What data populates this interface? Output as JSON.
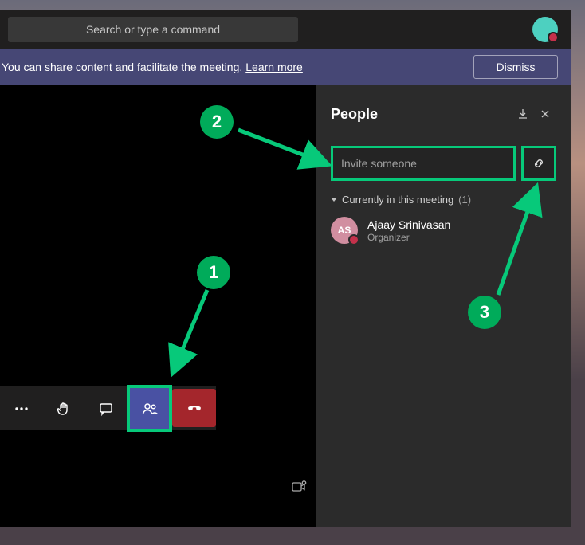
{
  "titlebar": {
    "search_placeholder": "Search or type a command"
  },
  "banner": {
    "text": "You can share content and facilitate the meeting.",
    "link": "Learn more",
    "dismiss": "Dismiss"
  },
  "people_panel": {
    "title": "People",
    "invite_placeholder": "Invite someone",
    "section_label": "Currently in this meeting",
    "section_count": "(1)",
    "participants": [
      {
        "initials": "AS",
        "name": "Ajaay Srinivasan",
        "role": "Organizer"
      }
    ]
  },
  "annotations": {
    "1": "1",
    "2": "2",
    "3": "3"
  },
  "colors": {
    "accent": "#07c97a",
    "danger": "#a4262c",
    "banner": "#464775"
  }
}
